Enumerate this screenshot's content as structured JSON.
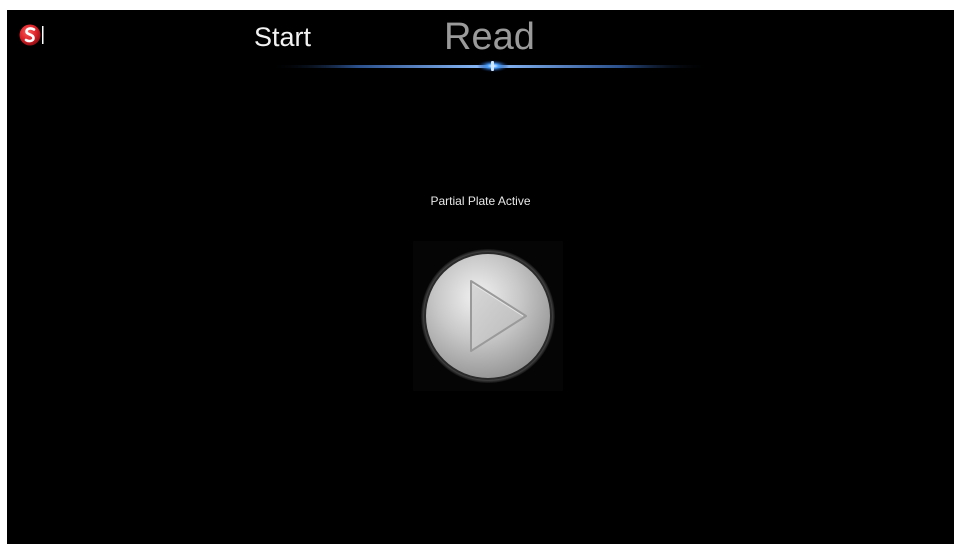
{
  "app": {
    "logo_icon": "app-logo-icon",
    "brand_color": "#d81f26"
  },
  "header": {
    "tabs": [
      {
        "label": "Start",
        "active": false
      },
      {
        "label": "Read",
        "active": true
      }
    ],
    "indicator_color": "#3d8bff"
  },
  "main": {
    "status_text": "Partial Plate Active",
    "play_button": {
      "icon": "play-icon"
    }
  }
}
